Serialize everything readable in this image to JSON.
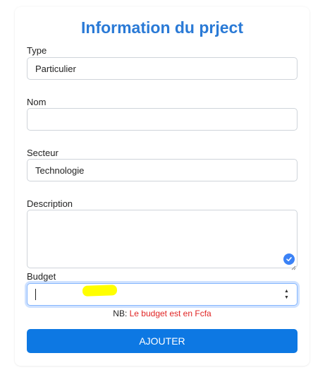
{
  "form": {
    "title": "Information du prject",
    "type": {
      "label": "Type",
      "value": "Particulier"
    },
    "nom": {
      "label": "Nom",
      "value": ""
    },
    "secteur": {
      "label": "Secteur",
      "value": "Technologie"
    },
    "description": {
      "label": "Description",
      "value": ""
    },
    "budget": {
      "label": "Budget",
      "value": ""
    },
    "note_prefix": "NB: ",
    "note_text": "Le budget est en Fcfa",
    "submit_label": "AJOUTER"
  },
  "colors": {
    "title": "#2a7ad6",
    "button": "#0d78e3",
    "note_red": "#e02424",
    "highlight": "#ffff00"
  },
  "icons": [
    "check-circle-icon",
    "resize-grip-icon",
    "spinner-up-icon",
    "spinner-down-icon"
  ]
}
